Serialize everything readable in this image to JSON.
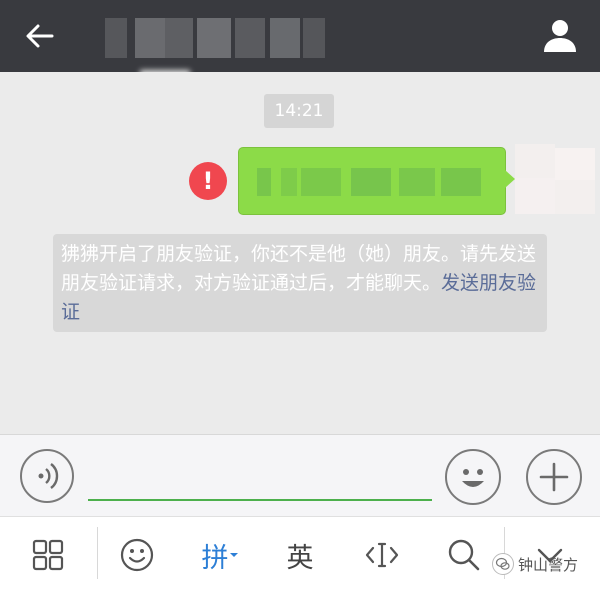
{
  "chat": {
    "timestamp": "14:21",
    "notice_text": "狒狒开启了朋友验证，你还不是他（她）朋友。请先发送朋友验证请求，对方验证通过后，才能聊天。",
    "notice_link": "发送朋友验证"
  },
  "input": {
    "value": "",
    "placeholder": ""
  },
  "ime": {
    "pinyin_label": "拼",
    "english_label": "英"
  },
  "watermark": {
    "label": "钟山警方"
  },
  "colors": {
    "topbar": "#393a3f",
    "bubble": "#8cdb48",
    "error": "#f0474f",
    "link": "#5a6c98",
    "input_underline": "#4cb04c",
    "ime_active": "#2d7fd6"
  },
  "icons": [
    "back-arrow-icon",
    "profile-icon",
    "error-icon",
    "voice-icon",
    "emoji-icon",
    "plus-icon",
    "grid-icon",
    "smiley-icon",
    "cursor-icon",
    "search-icon",
    "chevron-down-icon"
  ]
}
